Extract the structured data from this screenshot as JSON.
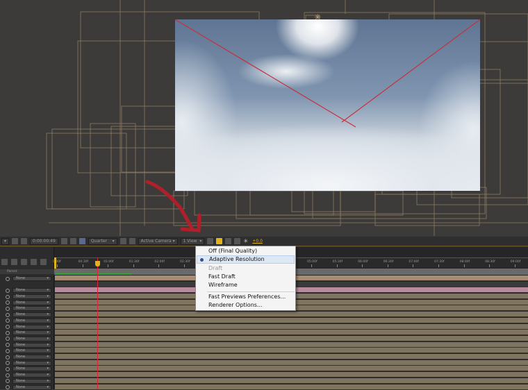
{
  "toolbar": {
    "timecode": "0:00:00:49",
    "resolution": "Quarter",
    "camera": "Active Camera",
    "views": "1 View",
    "exposure": "+0.0"
  },
  "timeline": {
    "parent_header": "Parent",
    "ruler_ticks": [
      "0:00f",
      "00:30f",
      "01:00f",
      "01:30f",
      "02:00f",
      "02:30f",
      "03:00f",
      "03:30f",
      "04:00f",
      "04:30f",
      "05:00f",
      "05:30f",
      "06:00f",
      "06:30f",
      "07:00f",
      "07:30f",
      "08:00f",
      "08:30f",
      "09:00f"
    ],
    "parent_value": "None"
  },
  "menu": {
    "items": [
      {
        "label": "Off (Final Quality)",
        "state": "normal"
      },
      {
        "label": "Adaptive Resolution",
        "state": "selected"
      },
      {
        "label": "Draft",
        "state": "disabled"
      },
      {
        "label": "Fast Draft",
        "state": "normal"
      },
      {
        "label": "Wireframe",
        "state": "normal"
      },
      {
        "label": "Fast Previews Preferences...",
        "state": "normal"
      },
      {
        "label": "Renderer Options...",
        "state": "normal"
      }
    ]
  },
  "colors": {
    "accent": "#e2b21a",
    "playhead": "#dd2233",
    "layer_tan": "#a78c72",
    "layer_pink": "#b78a9c",
    "layer_olive": "#7e7460",
    "annotation_arrow": "#b0202a"
  }
}
